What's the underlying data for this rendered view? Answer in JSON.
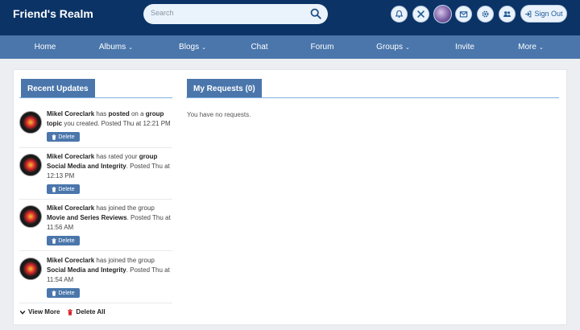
{
  "header": {
    "brand": "Friend's Realm",
    "search_placeholder": "Search",
    "signout_label": "Sign Out"
  },
  "nav": {
    "items": [
      {
        "label": "Home",
        "dropdown": ""
      },
      {
        "label": "Albums",
        "dropdown": "⌄"
      },
      {
        "label": "Blogs",
        "dropdown": "⌄"
      },
      {
        "label": "Chat",
        "dropdown": ""
      },
      {
        "label": "Forum",
        "dropdown": ""
      },
      {
        "label": "Groups",
        "dropdown": "⌄"
      },
      {
        "label": "Invite",
        "dropdown": ""
      },
      {
        "label": "More",
        "dropdown": "⌄"
      }
    ]
  },
  "recent": {
    "title": "Recent Updates",
    "items": [
      {
        "user": "Mikel Coreclark",
        "text1": " has ",
        "act": "posted",
        "text2": " on a ",
        "obj": "group topic",
        "text3": " you created. Posted Thu at 12:21 PM"
      },
      {
        "user": "Mikel Coreclark",
        "text1": " has rated your ",
        "act": "group",
        "text2": " ",
        "obj": "Social Media and Integrity",
        "text3": ". Posted Thu at 12:13 PM"
      },
      {
        "user": "Mikel Coreclark",
        "text1": " has joined the group ",
        "act": "",
        "text2": "",
        "obj": "Movie and Series Reviews",
        "text3": ". Posted Thu at 11:56 AM"
      },
      {
        "user": "Mikel Coreclark",
        "text1": " has joined the group ",
        "act": "",
        "text2": "",
        "obj": "Social Media and Integrity",
        "text3": ". Posted Thu at 11:54 AM"
      }
    ],
    "delete_label": "Delete",
    "view_more": "View More",
    "delete_all": "Delete All"
  },
  "requests": {
    "title": "My Requests (0)",
    "empty": "You have no requests."
  },
  "colors": {
    "topbar": "#0b3366",
    "nav": "#4a76ab",
    "accent": "#4a76ab",
    "delete_all": "#d9262b"
  }
}
